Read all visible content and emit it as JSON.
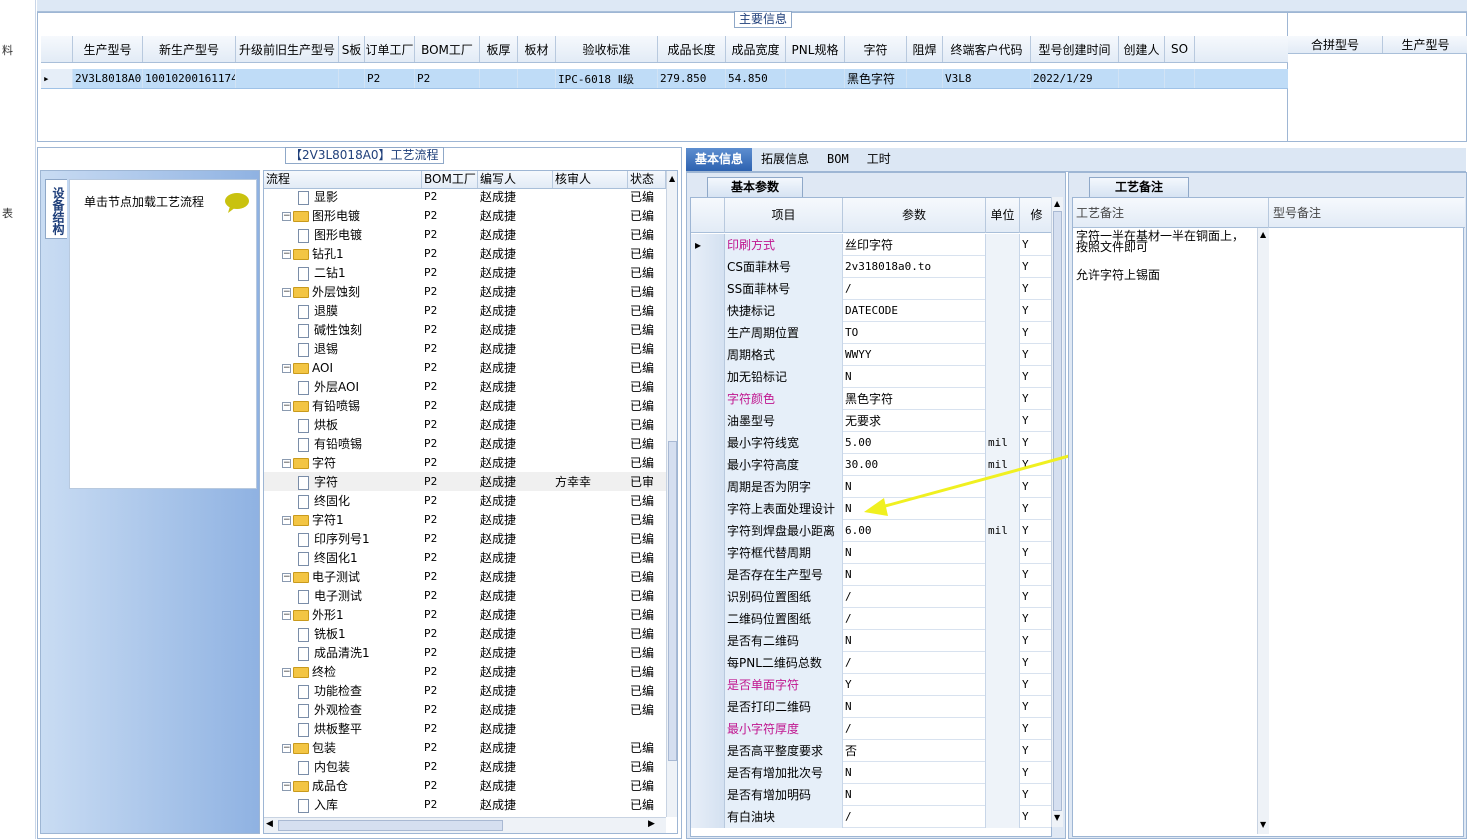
{
  "left_strip": {
    "chars": [
      "料",
      "表"
    ]
  },
  "main_group": {
    "title": "主要信息",
    "columns": [
      "生产型号",
      "新生产型号",
      "升级前旧生产型号",
      "S板",
      "订单工厂",
      "BOM工厂",
      "板厚",
      "板材",
      "验收标准",
      "成品长度",
      "成品宽度",
      "PNL规格",
      "字符",
      "阻焊",
      "终端客户代码",
      "型号创建时间",
      "创建人",
      "SO"
    ],
    "row": [
      "2V3L8018A0",
      "10010200161174",
      "",
      "",
      "P2",
      "P2",
      "",
      "",
      "IPC-6018 Ⅱ级",
      "279.850",
      "54.850",
      "",
      "黑色字符",
      "",
      "V3L8",
      "2022/1/29",
      "",
      ""
    ],
    "side_columns": [
      "合拼型号",
      "生产型号"
    ]
  },
  "process_group": {
    "title": "【2V3L8018A0】工艺流程",
    "side_tab": "设备结构",
    "hint": "单击节点加载工艺流程",
    "columns": [
      "流程",
      "BOM工厂",
      "编写人",
      "核审人",
      "状态"
    ],
    "rows": [
      {
        "indent": 2,
        "type": "doc",
        "name": "显影",
        "bom": "P2",
        "writer": "赵成捷",
        "reviewer": "",
        "status": "已编"
      },
      {
        "indent": 1,
        "type": "folder",
        "name": "图形电镀",
        "bom": "P2",
        "writer": "赵成捷",
        "reviewer": "",
        "status": "已编"
      },
      {
        "indent": 2,
        "type": "doc",
        "name": "图形电镀",
        "bom": "P2",
        "writer": "赵成捷",
        "reviewer": "",
        "status": "已编"
      },
      {
        "indent": 1,
        "type": "folder",
        "name": "钻孔1",
        "bom": "P2",
        "writer": "赵成捷",
        "reviewer": "",
        "status": "已编"
      },
      {
        "indent": 2,
        "type": "doc",
        "name": "二钻1",
        "bom": "P2",
        "writer": "赵成捷",
        "reviewer": "",
        "status": "已编"
      },
      {
        "indent": 1,
        "type": "folder",
        "name": "外层蚀刻",
        "bom": "P2",
        "writer": "赵成捷",
        "reviewer": "",
        "status": "已编"
      },
      {
        "indent": 2,
        "type": "doc",
        "name": "退膜",
        "bom": "P2",
        "writer": "赵成捷",
        "reviewer": "",
        "status": "已编"
      },
      {
        "indent": 2,
        "type": "doc",
        "name": "碱性蚀刻",
        "bom": "P2",
        "writer": "赵成捷",
        "reviewer": "",
        "status": "已编"
      },
      {
        "indent": 2,
        "type": "doc",
        "name": "退锡",
        "bom": "P2",
        "writer": "赵成捷",
        "reviewer": "",
        "status": "已编"
      },
      {
        "indent": 1,
        "type": "folder",
        "name": "AOI",
        "bom": "P2",
        "writer": "赵成捷",
        "reviewer": "",
        "status": "已编"
      },
      {
        "indent": 2,
        "type": "doc",
        "name": "外层AOI",
        "bom": "P2",
        "writer": "赵成捷",
        "reviewer": "",
        "status": "已编"
      },
      {
        "indent": 1,
        "type": "folder",
        "name": "有铅喷锡",
        "bom": "P2",
        "writer": "赵成捷",
        "reviewer": "",
        "status": "已编"
      },
      {
        "indent": 2,
        "type": "doc",
        "name": "烘板",
        "bom": "P2",
        "writer": "赵成捷",
        "reviewer": "",
        "status": "已编"
      },
      {
        "indent": 2,
        "type": "doc",
        "name": "有铅喷锡",
        "bom": "P2",
        "writer": "赵成捷",
        "reviewer": "",
        "status": "已编"
      },
      {
        "indent": 1,
        "type": "folder",
        "name": "字符",
        "bom": "P2",
        "writer": "赵成捷",
        "reviewer": "",
        "status": "已编"
      },
      {
        "indent": 2,
        "type": "doc",
        "name": "字符",
        "bom": "P2",
        "writer": "赵成捷",
        "reviewer": "方幸幸",
        "status": "已审",
        "selected": true
      },
      {
        "indent": 2,
        "type": "doc",
        "name": "终固化",
        "bom": "P2",
        "writer": "赵成捷",
        "reviewer": "",
        "status": "已编"
      },
      {
        "indent": 1,
        "type": "folder",
        "name": "字符1",
        "bom": "P2",
        "writer": "赵成捷",
        "reviewer": "",
        "status": "已编"
      },
      {
        "indent": 2,
        "type": "doc",
        "name": "印序列号1",
        "bom": "P2",
        "writer": "赵成捷",
        "reviewer": "",
        "status": "已编"
      },
      {
        "indent": 2,
        "type": "doc",
        "name": "终固化1",
        "bom": "P2",
        "writer": "赵成捷",
        "reviewer": "",
        "status": "已编"
      },
      {
        "indent": 1,
        "type": "folder",
        "name": "电子测试",
        "bom": "P2",
        "writer": "赵成捷",
        "reviewer": "",
        "status": "已编"
      },
      {
        "indent": 2,
        "type": "doc",
        "name": "电子测试",
        "bom": "P2",
        "writer": "赵成捷",
        "reviewer": "",
        "status": "已编"
      },
      {
        "indent": 1,
        "type": "folder",
        "name": "外形1",
        "bom": "P2",
        "writer": "赵成捷",
        "reviewer": "",
        "status": "已编"
      },
      {
        "indent": 2,
        "type": "doc",
        "name": "铣板1",
        "bom": "P2",
        "writer": "赵成捷",
        "reviewer": "",
        "status": "已编"
      },
      {
        "indent": 2,
        "type": "doc",
        "name": "成品清洗1",
        "bom": "P2",
        "writer": "赵成捷",
        "reviewer": "",
        "status": "已编"
      },
      {
        "indent": 1,
        "type": "folder",
        "name": "终检",
        "bom": "P2",
        "writer": "赵成捷",
        "reviewer": "",
        "status": "已编"
      },
      {
        "indent": 2,
        "type": "doc",
        "name": "功能检查",
        "bom": "P2",
        "writer": "赵成捷",
        "reviewer": "",
        "status": "已编"
      },
      {
        "indent": 2,
        "type": "doc",
        "name": "外观检查",
        "bom": "P2",
        "writer": "赵成捷",
        "reviewer": "",
        "status": "已编"
      },
      {
        "indent": 2,
        "type": "doc",
        "name": "烘板整平",
        "bom": "P2",
        "writer": "赵成捷",
        "reviewer": "",
        "status": ""
      },
      {
        "indent": 1,
        "type": "folder",
        "name": "包装",
        "bom": "P2",
        "writer": "赵成捷",
        "reviewer": "",
        "status": "已编"
      },
      {
        "indent": 2,
        "type": "doc",
        "name": "内包装",
        "bom": "P2",
        "writer": "赵成捷",
        "reviewer": "",
        "status": "已编"
      },
      {
        "indent": 1,
        "type": "folder",
        "name": "成品仓",
        "bom": "P2",
        "writer": "赵成捷",
        "reviewer": "",
        "status": "已编"
      },
      {
        "indent": 2,
        "type": "doc",
        "name": "入库",
        "bom": "P2",
        "writer": "赵成捷",
        "reviewer": "",
        "status": "已编"
      }
    ]
  },
  "tabs": [
    "基本信息",
    "拓展信息",
    "BOM",
    "工时"
  ],
  "basic_params": {
    "title": "基本参数",
    "columns": [
      "项目",
      "参数",
      "单位",
      "修"
    ],
    "rows": [
      {
        "item": "印刷方式",
        "value": "丝印字符",
        "unit": "",
        "flag": "Y",
        "pink": true
      },
      {
        "item": "CS面菲林号",
        "value": "2v318018a0.to",
        "unit": "",
        "flag": "Y"
      },
      {
        "item": "SS面菲林号",
        "value": "/",
        "unit": "",
        "flag": "Y"
      },
      {
        "item": "快捷标记",
        "value": "DATECODE",
        "unit": "",
        "flag": "Y"
      },
      {
        "item": "生产周期位置",
        "value": "TO",
        "unit": "",
        "flag": "Y"
      },
      {
        "item": "周期格式",
        "value": "WWYY",
        "unit": "",
        "flag": "Y"
      },
      {
        "item": "加无铅标记",
        "value": "N",
        "unit": "",
        "flag": "Y"
      },
      {
        "item": "字符颜色",
        "value": "黑色字符",
        "unit": "",
        "flag": "Y",
        "pink": true
      },
      {
        "item": "油墨型号",
        "value": "无要求",
        "unit": "",
        "flag": "Y"
      },
      {
        "item": "最小字符线宽",
        "value": "5.00",
        "unit": "mil",
        "flag": "Y"
      },
      {
        "item": "最小字符高度",
        "value": "30.00",
        "unit": "mil",
        "flag": "Y"
      },
      {
        "item": "周期是否为阴字",
        "value": "N",
        "unit": "",
        "flag": "Y"
      },
      {
        "item": "字符上表面处理设计",
        "value": "N",
        "unit": "",
        "flag": "Y"
      },
      {
        "item": "字符到焊盘最小距离",
        "value": "6.00",
        "unit": "mil",
        "flag": "Y"
      },
      {
        "item": "字符框代替周期",
        "value": "N",
        "unit": "",
        "flag": "Y"
      },
      {
        "item": "是否存在生产型号",
        "value": "N",
        "unit": "",
        "flag": "Y"
      },
      {
        "item": "识别码位置图纸",
        "value": "/",
        "unit": "",
        "flag": "Y"
      },
      {
        "item": "二维码位置图纸",
        "value": "/",
        "unit": "",
        "flag": "Y"
      },
      {
        "item": "是否有二维码",
        "value": "N",
        "unit": "",
        "flag": "Y"
      },
      {
        "item": "每PNL二维码总数",
        "value": "/",
        "unit": "",
        "flag": "Y"
      },
      {
        "item": "是否单面字符",
        "value": "Y",
        "unit": "",
        "flag": "Y",
        "pink": true
      },
      {
        "item": "是否打印二维码",
        "value": "N",
        "unit": "",
        "flag": "Y"
      },
      {
        "item": "最小字符厚度",
        "value": "/",
        "unit": "",
        "flag": "Y",
        "pink": true
      },
      {
        "item": "是否高平整度要求",
        "value": "否",
        "unit": "",
        "flag": "Y"
      },
      {
        "item": "是否有增加批次号",
        "value": "N",
        "unit": "",
        "flag": "Y"
      },
      {
        "item": "是否有增加明码",
        "value": "N",
        "unit": "",
        "flag": "Y"
      },
      {
        "item": "有白油块",
        "value": "/",
        "unit": "",
        "flag": "Y"
      }
    ]
  },
  "remarks": {
    "title": "工艺备注",
    "col1": "工艺备注",
    "col2": "型号备注",
    "line1": "字符一半在基材一半在铜面上，",
    "line2": "按照文件即可",
    "line3": "允许字符上锡面"
  },
  "colors": {
    "accent": "#2d62b0",
    "selection": "#bfdcf7",
    "pink": "#c0158f",
    "arrow": "#f0f020"
  }
}
